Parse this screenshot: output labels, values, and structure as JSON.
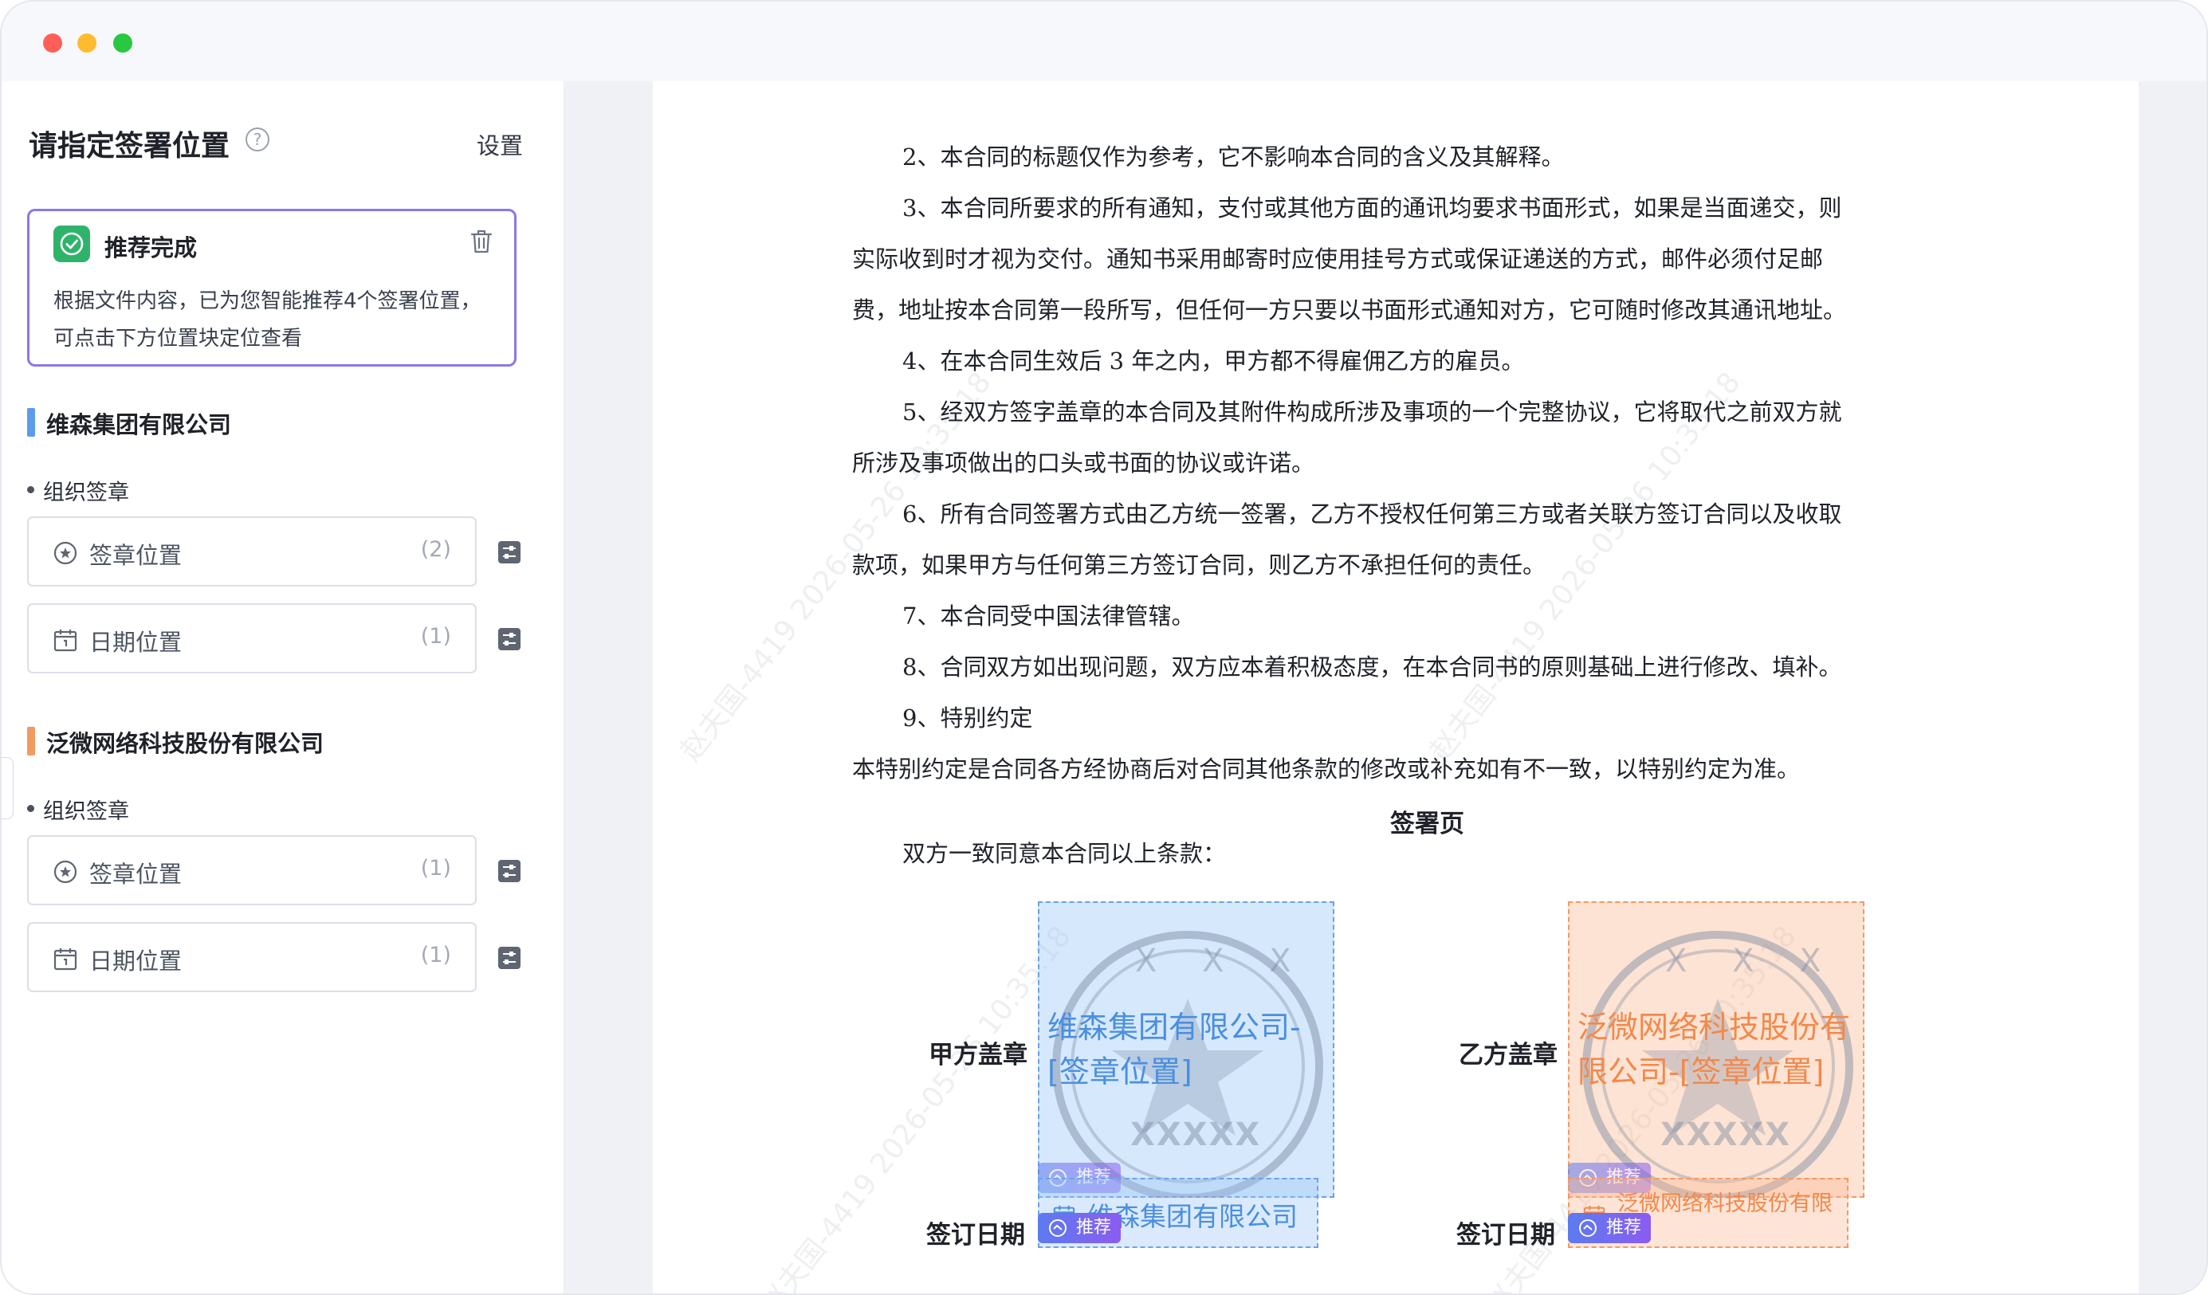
{
  "sidebar": {
    "title": "请指定签署位置",
    "settings_label": "设置",
    "recommend": {
      "title": "推荐完成",
      "description": "根据文件内容，已为您智能推荐4个签署位置，可点击下方位置块定位查看"
    },
    "companies": [
      {
        "name": "维森集团有限公司",
        "color": "#5b9bea",
        "group_label": "组织签章",
        "fields": [
          {
            "label": "签章位置",
            "count": "(2)"
          },
          {
            "label": "日期位置",
            "count": "(1)"
          }
        ]
      },
      {
        "name": "泛微网络科技股份有限公司",
        "color": "#f39a63",
        "group_label": "组织签章",
        "fields": [
          {
            "label": "签章位置",
            "count": "(1)"
          },
          {
            "label": "日期位置",
            "count": "(1)"
          }
        ]
      }
    ]
  },
  "document": {
    "lines": [
      "2、本合同的标题仅作为参考，它不影响本合同的含义及其解释。",
      "3、本合同所要求的所有通知，支付或其他方面的通讯均要求书面形式，如果是当面递交，则",
      "实际收到时才视为交付。通知书采用邮寄时应使用挂号方式或保证递送的方式，邮件必须付足邮",
      "费，地址按本合同第一段所写，但任何一方只要以书面形式通知对方，它可随时修改其通讯地址。",
      "4、在本合同生效后  3  年之内，甲方都不得雇佣乙方的雇员。",
      "5、经双方签字盖章的本合同及其附件构成所涉及事项的一个完整协议，它将取代之前双方就",
      "所涉及事项做出的口头或书面的协议或许诺。",
      "6、所有合同签署方式由乙方统一签署，乙方不授权任何第三方或者关联方签订合同以及收取",
      "款项，如果甲方与任何第三方签订合同，则乙方不承担任何的责任。",
      "7、本合同受中国法律管辖。",
      "8、合同双方如出现问题，双方应本着积极态度，在本合同书的原则基础上进行修改、填补。",
      "9、特别约定",
      "本特别约定是合同各方经协商后对合同其他条款的修改或补充如有不一致，以特别约定为准。"
    ],
    "signature_heading": "签署页",
    "agree_line": "双方一致同意本合同以上条款：",
    "party_a_seal_label": "甲方盖章",
    "party_b_seal_label": "乙方盖章",
    "party_a_date_label": "签订日期",
    "party_b_date_label": "签订日期",
    "party_a_seal_box": "维森集团有限公司-[签章位置]",
    "party_b_seal_box": "泛微网络科技股份有限公司-[签章位置]",
    "party_a_date_box": "维森集团有限公司",
    "party_b_date_box": "泛微网络科技股份有限",
    "recommend_tag": "推荐",
    "seal_placeholder_text": "XXXXX",
    "watermark_text": "赵夫国-4419  2026-05-26 10:35:18"
  },
  "colors": {
    "accent_purple": "#8d76e8",
    "success_green": "#2fb36b",
    "party_a_blue": "#4a8fe0",
    "party_b_orange": "#f3884a"
  },
  "icons": {
    "help": "question-circle-icon",
    "trash": "trash-icon",
    "check": "check-circle-icon",
    "seal": "seal-icon",
    "calendar": "calendar-icon",
    "adjust": "adjust-icon"
  }
}
